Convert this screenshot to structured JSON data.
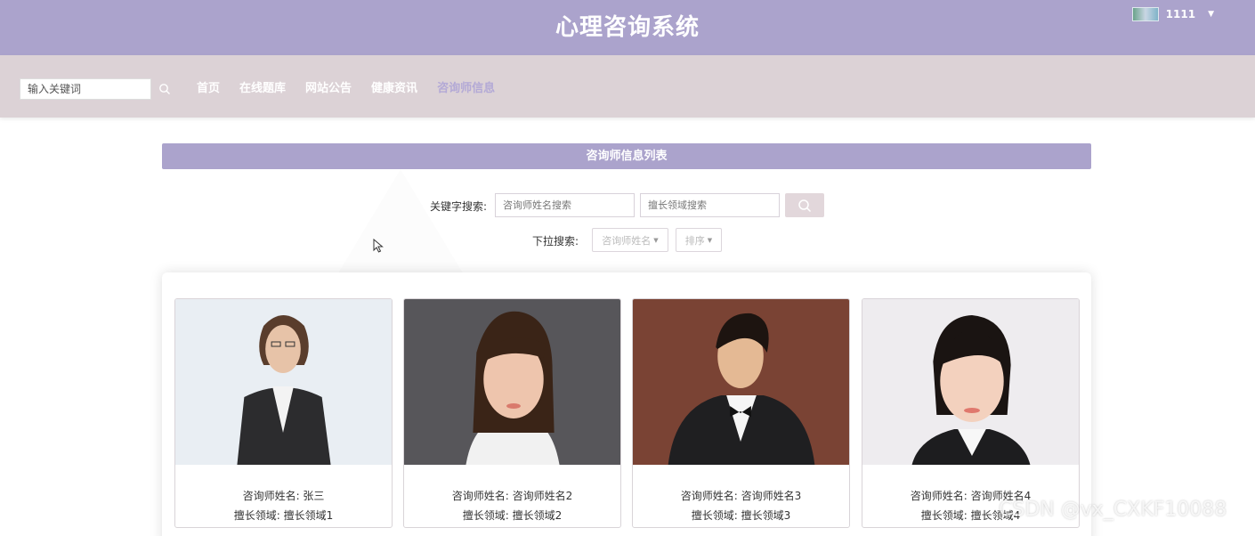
{
  "header": {
    "title": "心理咨询系统",
    "username": "1111"
  },
  "nav": {
    "search_placeholder": "输入关键词",
    "links": [
      "首页",
      "在线题库",
      "网站公告",
      "健康资讯",
      "咨询师信息"
    ],
    "active_index": 4
  },
  "section": {
    "title": "咨询师信息列表"
  },
  "search": {
    "keyword_label": "关键字搜索:",
    "name_placeholder": "咨询师姓名搜索",
    "field_placeholder": "擅长领域搜索",
    "dropdown_label": "下拉搜索:",
    "dropdown_name": "咨询师姓名",
    "dropdown_sort": "排序"
  },
  "cards": [
    {
      "name_label": "咨询师姓名: 张三",
      "field_label": "擅长领域: 擅长领域1"
    },
    {
      "name_label": "咨询师姓名: 咨询师姓名2",
      "field_label": "擅长领域: 擅长领域2"
    },
    {
      "name_label": "咨询师姓名: 咨询师姓名3",
      "field_label": "擅长领域: 擅长领域3"
    },
    {
      "name_label": "咨询师姓名: 咨询师姓名4",
      "field_label": "擅长领域: 擅长领域4"
    }
  ],
  "watermark": "CSDN @vx_CXKF10088",
  "colors": {
    "header_bg": "#aba3cc",
    "nav_bg": "#dcd2d6",
    "active_link": "#b3a9d6",
    "search_button": "#e2d7db"
  }
}
